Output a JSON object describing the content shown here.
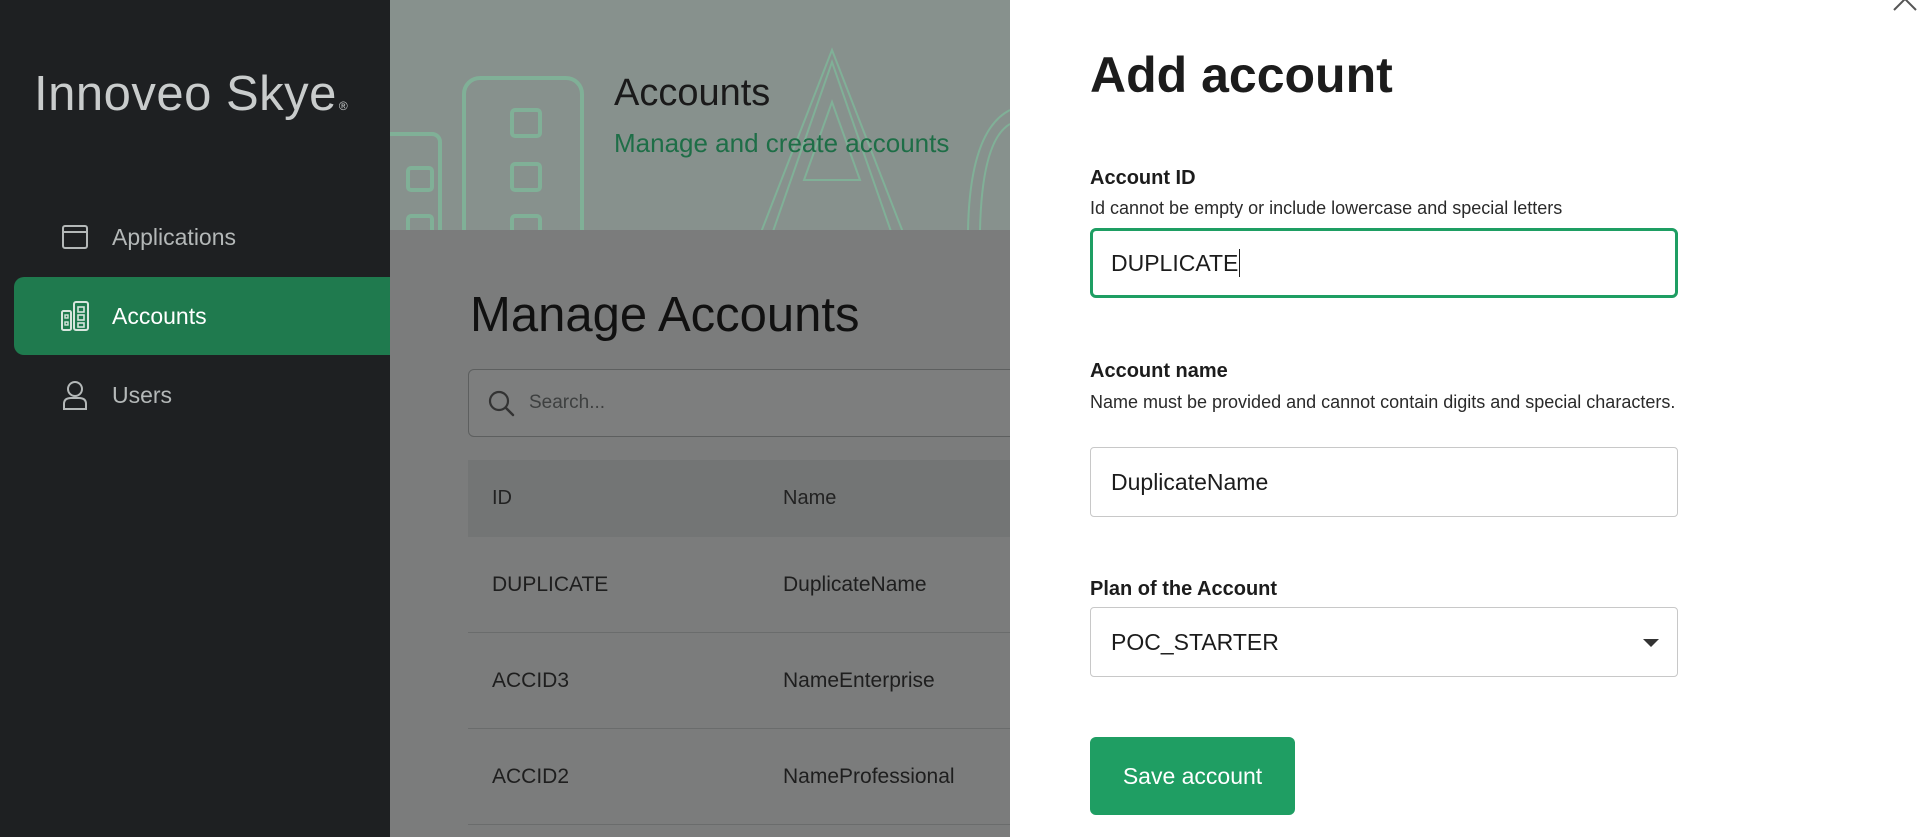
{
  "app": {
    "logo_text": "Innoveo Skye",
    "logo_mark": "®"
  },
  "sidebar": {
    "items": [
      {
        "label": "Applications",
        "icon": "window-icon",
        "active": false
      },
      {
        "label": "Accounts",
        "icon": "accounts-icon",
        "active": true
      },
      {
        "label": "Users",
        "icon": "user-icon",
        "active": false
      }
    ]
  },
  "hero": {
    "title": "Accounts",
    "subtitle": "Manage and create accounts"
  },
  "main": {
    "page_title": "Manage Accounts",
    "search_placeholder": "Search...",
    "table": {
      "columns": [
        "ID",
        "Name"
      ],
      "rows": [
        {
          "id": "DUPLICATE",
          "name": "DuplicateName"
        },
        {
          "id": "ACCID3",
          "name": "NameEnterprise"
        },
        {
          "id": "ACCID2",
          "name": "NameProfessional"
        }
      ]
    }
  },
  "drawer": {
    "title": "Add account",
    "account_id": {
      "label": "Account ID",
      "hint": "Id cannot be empty or include lowercase and special letters",
      "value": "DUPLICATE"
    },
    "account_name": {
      "label": "Account name",
      "hint": "Name must be provided and cannot contain digits and special characters.",
      "value": "DuplicateName"
    },
    "plan": {
      "label": "Plan of the Account",
      "value": "POC_STARTER"
    },
    "save_label": "Save account"
  },
  "colors": {
    "accent": "#1f9e63",
    "sidebar_active": "#1f7a4e",
    "hero_subtitle": "#1e6e47"
  }
}
